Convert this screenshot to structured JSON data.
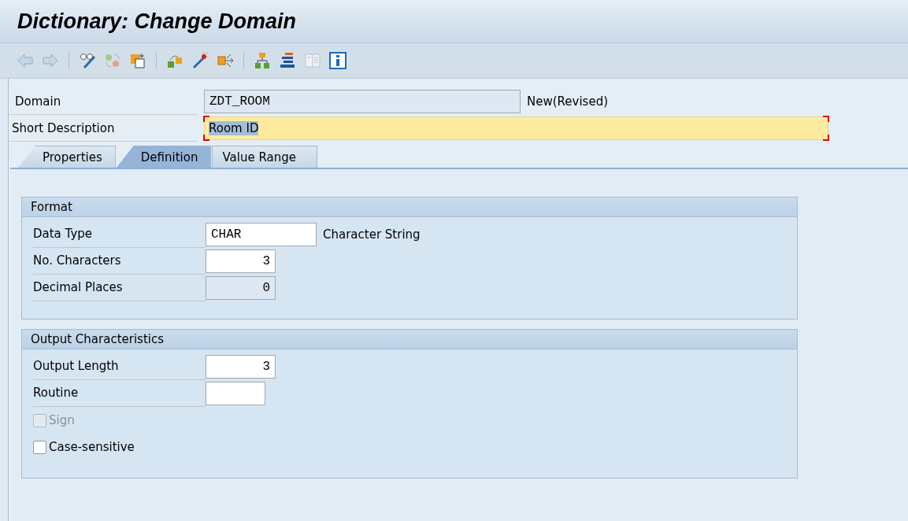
{
  "window": {
    "title": "Dictionary: Change Domain"
  },
  "header_fields": [
    {
      "label": "Domain",
      "value": "ZDT_ROOM",
      "kind": "readonly",
      "note": "New(Revised)"
    },
    {
      "label": "Short Description",
      "value": "Room ID",
      "kind": "focused"
    }
  ],
  "tabs": [
    {
      "label": "Properties",
      "selected": false
    },
    {
      "label": "Definition",
      "selected": true
    },
    {
      "label": "Value Range",
      "selected": false
    }
  ],
  "groups": [
    {
      "title": "Format",
      "rows": [
        {
          "kind": "text_field",
          "label": "Data Type",
          "value": "CHAR",
          "disabled": false,
          "note": "Character String"
        },
        {
          "kind": "number_field",
          "label": "No. Characters",
          "value": "3",
          "disabled": false
        },
        {
          "kind": "number_field",
          "label": "Decimal Places",
          "value": "0",
          "disabled": true
        }
      ]
    },
    {
      "title": "Output Characteristics",
      "rows": [
        {
          "kind": "number_field",
          "label": "Output Length",
          "value": "3",
          "disabled": false
        },
        {
          "kind": "text_field",
          "label": "Routine",
          "disabled": false
        },
        {
          "kind": "checkbox",
          "label": "Sign",
          "checked": false,
          "disabled": true
        },
        {
          "kind": "checkbox",
          "label": "Case-sensitive",
          "checked": false,
          "disabled": false
        }
      ]
    }
  ]
}
